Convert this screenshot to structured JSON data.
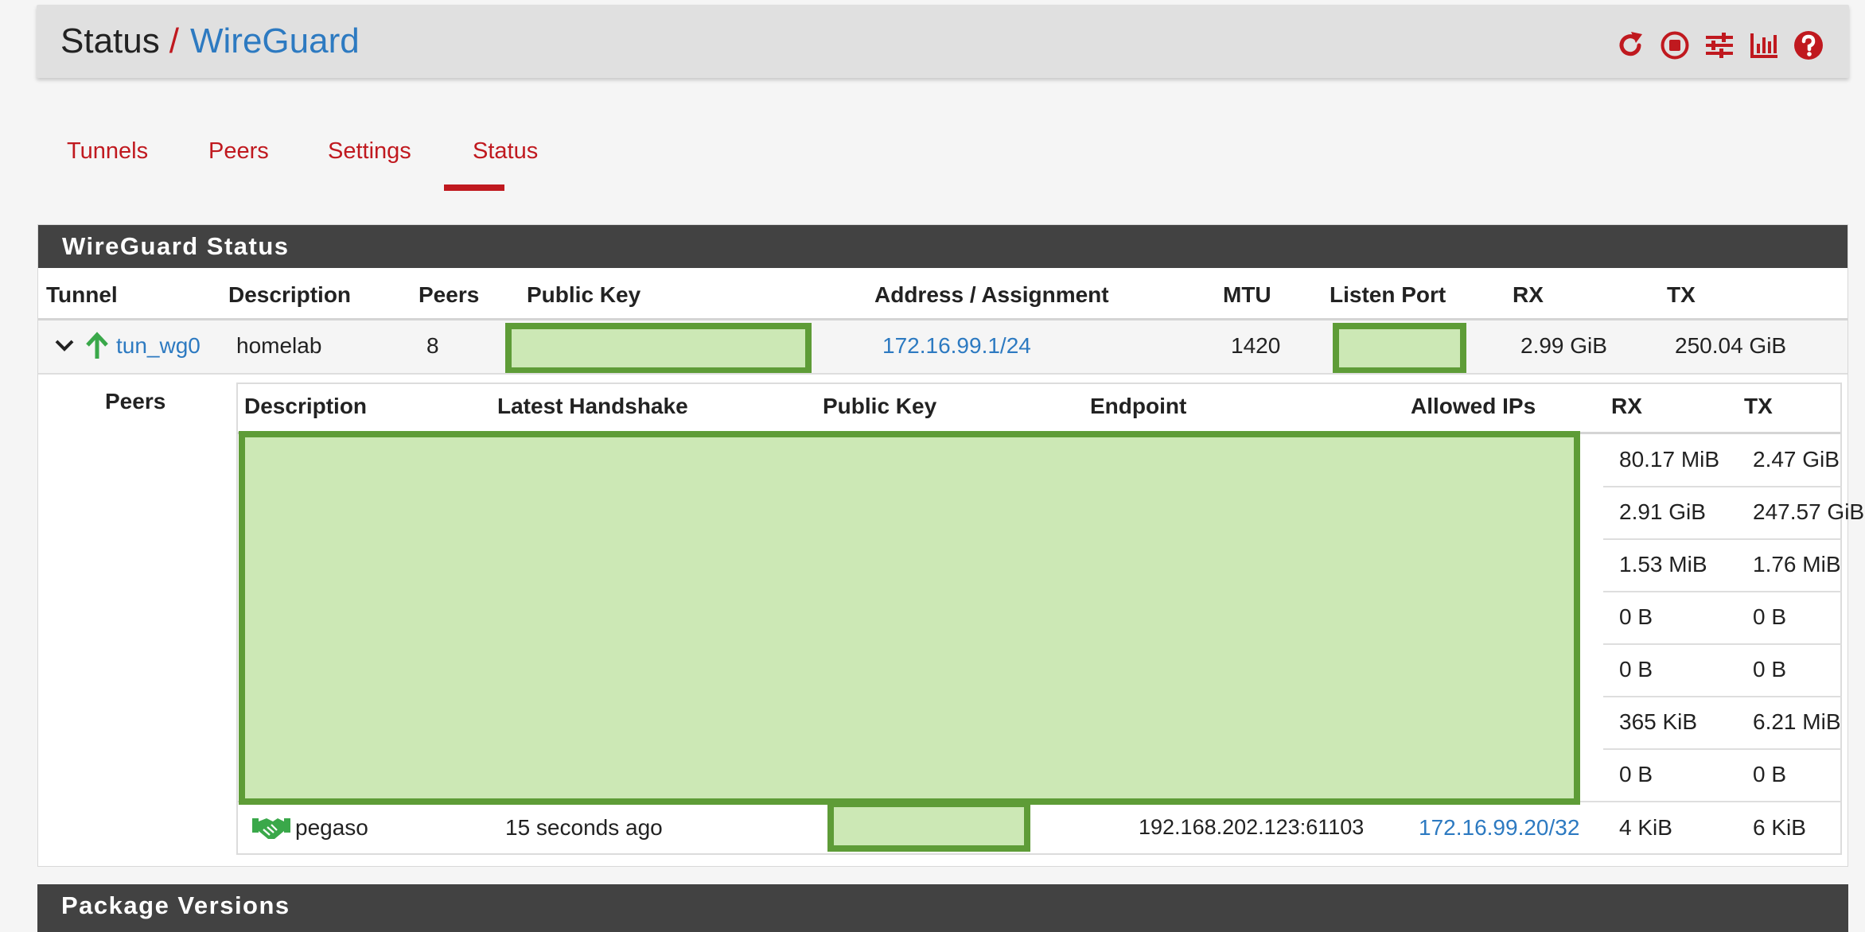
{
  "breadcrumb": {
    "status": "Status",
    "separator": "/",
    "current": "WireGuard"
  },
  "header_icons": [
    "reload-icon",
    "stop-icon",
    "sliders-icon",
    "bar-chart-icon",
    "help-icon"
  ],
  "tabs": [
    {
      "label": "Tunnels",
      "active": false
    },
    {
      "label": "Peers",
      "active": false
    },
    {
      "label": "Settings",
      "active": false
    },
    {
      "label": "Status",
      "active": true
    }
  ],
  "panel_title": "WireGuard Status",
  "tunnel_table": {
    "headers": [
      "Tunnel",
      "Description",
      "Peers",
      "Public Key",
      "Address / Assignment",
      "MTU",
      "Listen Port",
      "RX",
      "TX"
    ],
    "row": {
      "tunnel": "tun_wg0",
      "description": "homelab",
      "peers": "8",
      "address": "172.16.99.1/24",
      "mtu": "1420",
      "rx": "2.99 GiB",
      "tx": "250.04 GiB"
    }
  },
  "peers_label": "Peers",
  "peers_table": {
    "headers": [
      "Description",
      "Latest Handshake",
      "Public Key",
      "Endpoint",
      "Allowed IPs",
      "RX",
      "TX"
    ],
    "rows": [
      {
        "rx": "80.17 MiB",
        "tx": "2.47 GiB"
      },
      {
        "rx": "2.91 GiB",
        "tx": "247.57 GiB"
      },
      {
        "rx": "1.53 MiB",
        "tx": "1.76 MiB"
      },
      {
        "rx": "0 B",
        "tx": "0 B"
      },
      {
        "rx": "0 B",
        "tx": "0 B"
      },
      {
        "rx": "365 KiB",
        "tx": "6.21 MiB"
      },
      {
        "rx": "0 B",
        "tx": "0 B"
      },
      {
        "description": "pegaso",
        "handshake": "15 seconds ago",
        "endpoint": "192.168.202.123:61103",
        "allowed_ips": "172.16.99.20/32",
        "rx": "4 KiB",
        "tx": "6 KiB"
      }
    ]
  },
  "panel2_title": "Package Versions",
  "colors": {
    "accent_red": "#c0191f",
    "link_blue": "#2d7ac1",
    "heading_dark": "#424242",
    "redaction_fill": "#cce8b5",
    "redaction_border": "#5e9c37",
    "status_green": "#3aa84a"
  }
}
